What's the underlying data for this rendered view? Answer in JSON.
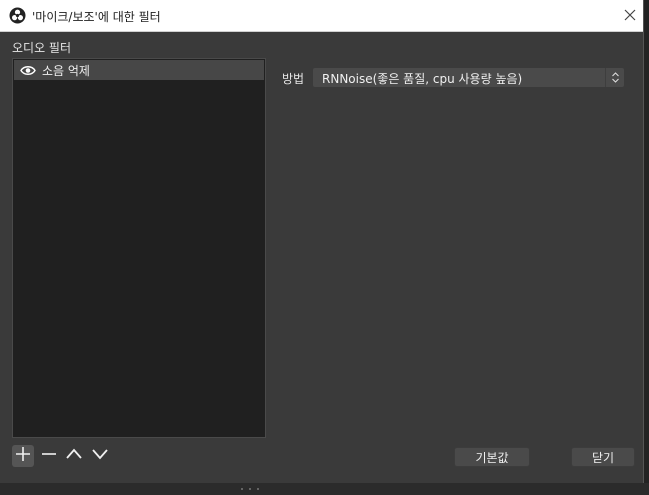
{
  "window": {
    "title": "'마이크/보조'에 대한 필터",
    "app_icon": "obs-logo-icon",
    "close_icon": "close-icon"
  },
  "audio_filters": {
    "section_label": "오디오 필터",
    "items": [
      {
        "name": "소음 억제",
        "visibility_icon": "eye-icon",
        "selected": true
      }
    ]
  },
  "settings": {
    "method_label": "방법",
    "method_value": "RNNoise(좋은 품질, cpu 사용량 높음)"
  },
  "toolbar": {
    "add_icon": "plus-icon",
    "remove_icon": "minus-icon",
    "move_up_icon": "chevron-up-icon",
    "move_down_icon": "chevron-down-icon"
  },
  "buttons": {
    "defaults_label": "기본값",
    "close_label": "닫기"
  },
  "colors": {
    "background": "#3a3a3a",
    "list_background": "#202020",
    "selected_row": "#474747",
    "control": "#4a4a4a",
    "text": "#f0f0f0",
    "titlebar": "#ffffff"
  }
}
